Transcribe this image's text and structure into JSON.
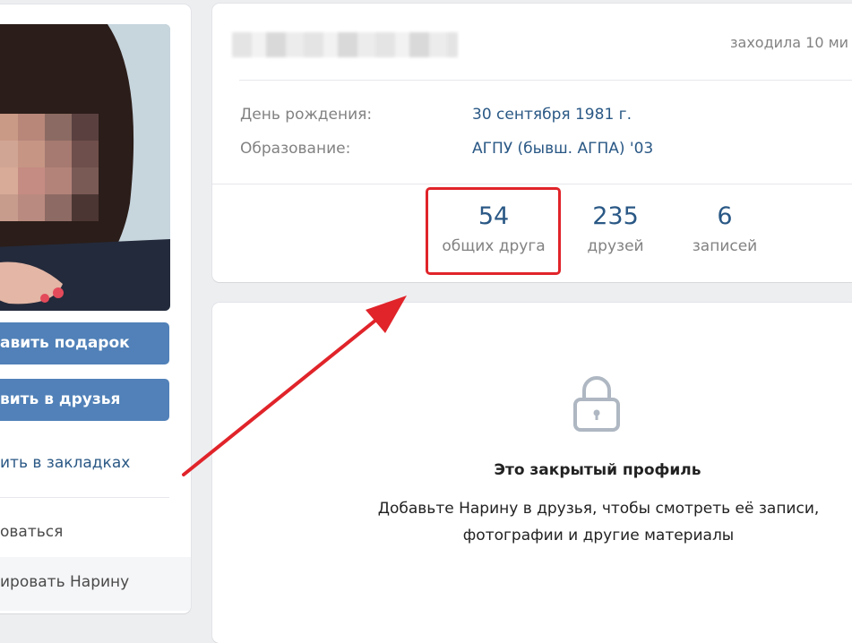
{
  "sidebar": {
    "gift_button": "авить подарок",
    "friend_button": "вить в друзья",
    "bookmark_link": "ить в закладках",
    "complain_link": "оваться",
    "block_link": "ировать Нарину"
  },
  "profile": {
    "last_seen": "заходила 10 ми",
    "fields": [
      {
        "label": "День рождения:",
        "value": "30 сентября 1981 г."
      },
      {
        "label": "Образование:",
        "value": "АГПУ (бывш. АГПА) '03"
      }
    ],
    "counters": [
      {
        "count": "54",
        "label": "общих друга"
      },
      {
        "count": "235",
        "label": "друзей"
      },
      {
        "count": "6",
        "label": "записей"
      }
    ]
  },
  "closed": {
    "title": "Это закрытый профиль",
    "desc_line1": "Добавьте Нарину в друзья, чтобы смотреть её записи,",
    "desc_line2": "фотографии и другие материалы"
  },
  "colors": {
    "accent": "#5181b8",
    "link": "#2a5885",
    "muted": "#828282",
    "annotation_red": "#e0242a"
  },
  "icons": [
    "lock-icon",
    "arrow-annotation"
  ]
}
